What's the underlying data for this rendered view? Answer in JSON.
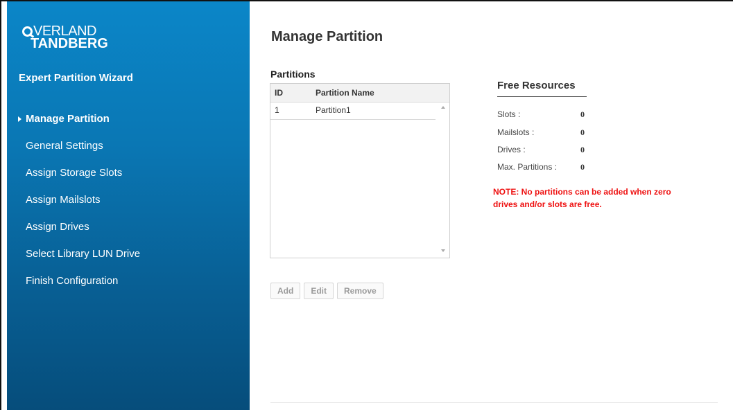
{
  "logo": {
    "top": "VERLAND",
    "bottom": "TANDBERG"
  },
  "sidebar": {
    "title": "Expert Partition Wizard",
    "items": [
      {
        "label": "Manage Partition",
        "active": true
      },
      {
        "label": "General Settings"
      },
      {
        "label": "Assign Storage Slots"
      },
      {
        "label": "Assign Mailslots"
      },
      {
        "label": "Assign Drives"
      },
      {
        "label": "Select Library LUN Drive"
      },
      {
        "label": "Finish Configuration"
      }
    ]
  },
  "main": {
    "title": "Manage Partition",
    "partitions_label": "Partitions",
    "table": {
      "headers": {
        "id": "ID",
        "name": "Partition Name"
      },
      "rows": [
        {
          "id": "1",
          "name": "Partition1"
        }
      ]
    },
    "buttons": {
      "add": "Add",
      "edit": "Edit",
      "remove": "Remove"
    }
  },
  "free_resources": {
    "title": "Free Resources",
    "slots": {
      "label": "Slots :",
      "value": "0"
    },
    "mailslots": {
      "label": "Mailslots :",
      "value": "0"
    },
    "drives": {
      "label": "Drives :",
      "value": "0"
    },
    "max_partitions": {
      "label": "Max. Partitions :",
      "value": "0"
    },
    "note": "NOTE: No partitions can be added when zero drives and/or slots are free."
  },
  "colors": {
    "sidebar": "#0a77b4",
    "note": "#ee1111"
  }
}
